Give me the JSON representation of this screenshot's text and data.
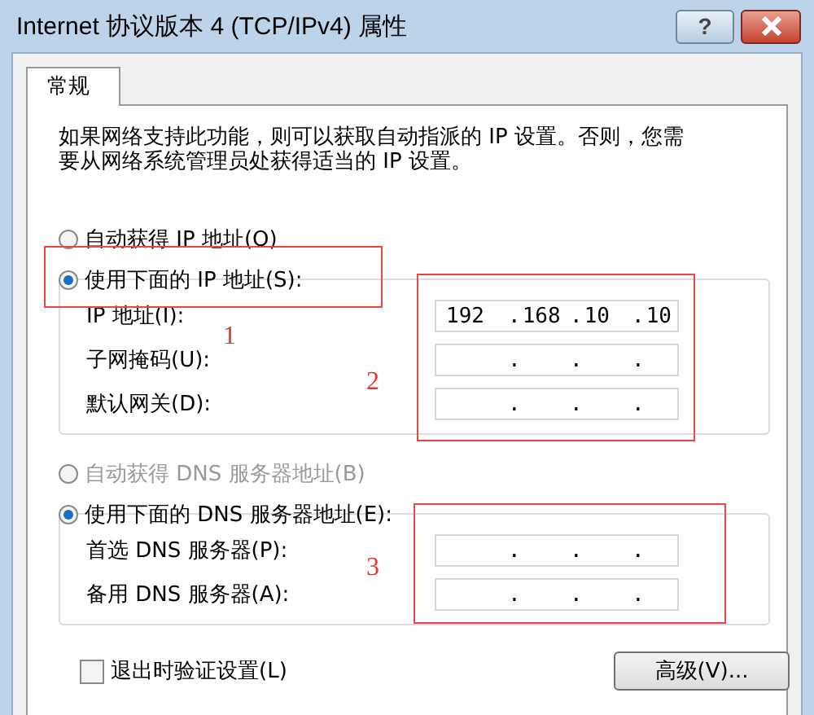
{
  "window": {
    "title": "Internet 协议版本 4 (TCP/IPv4) 属性",
    "help_label": "?"
  },
  "tabs": [
    {
      "label": "常规",
      "selected": true
    }
  ],
  "description": "如果网络支持此功能，则可以获取自动指派的 IP 设置。否则，您需要从网络系统管理员处获得适当的 IP 设置。",
  "ip_mode": [
    {
      "label": "自动获得 IP 地址(O)",
      "selected": false,
      "disabled": false
    },
    {
      "label": "使用下面的 IP 地址(S):",
      "selected": true,
      "disabled": false
    }
  ],
  "ip_fields": [
    {
      "label": "IP 地址(I):",
      "octets": [
        "192",
        "168",
        "10",
        "10"
      ],
      "dots": [
        ".",
        ".",
        "."
      ]
    },
    {
      "label": "子网掩码(U):",
      "dots": [
        ".",
        ".",
        "."
      ]
    },
    {
      "label": "默认网关(D):",
      "dots": [
        ".",
        ".",
        "."
      ]
    }
  ],
  "dns_mode": [
    {
      "label": "自动获得 DNS 服务器地址(B)",
      "selected": false,
      "disabled": true
    },
    {
      "label": "使用下面的 DNS 服务器地址(E):",
      "selected": true,
      "disabled": false
    }
  ],
  "dns_fields": [
    {
      "label": "首选 DNS 服务器(P):",
      "dots": [
        ".",
        ".",
        "."
      ]
    },
    {
      "label": "备用 DNS 服务器(A):",
      "dots": [
        ".",
        ".",
        "."
      ]
    }
  ],
  "checkbox": {
    "label": "退出时验证设置(L)",
    "checked": false
  },
  "advanced_button": {
    "label": "高级(V)..."
  },
  "annotations": [
    {
      "number": "1"
    },
    {
      "number": "2"
    },
    {
      "number": "3"
    }
  ]
}
